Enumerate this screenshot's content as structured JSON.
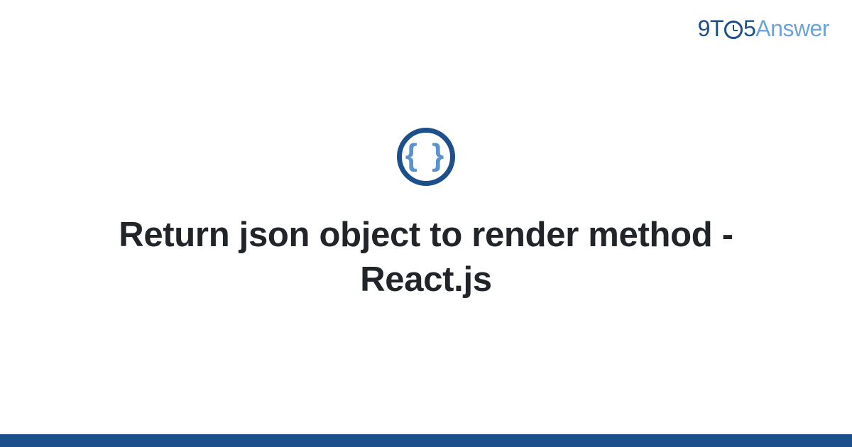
{
  "logo": {
    "prefix": "9T",
    "suffix": "5",
    "brand": "Answer"
  },
  "icon": {
    "glyph": "{ }"
  },
  "title": "Return json object to render method - React.js",
  "colors": {
    "primary": "#1d4f8c",
    "accent": "#6ea3d8"
  }
}
